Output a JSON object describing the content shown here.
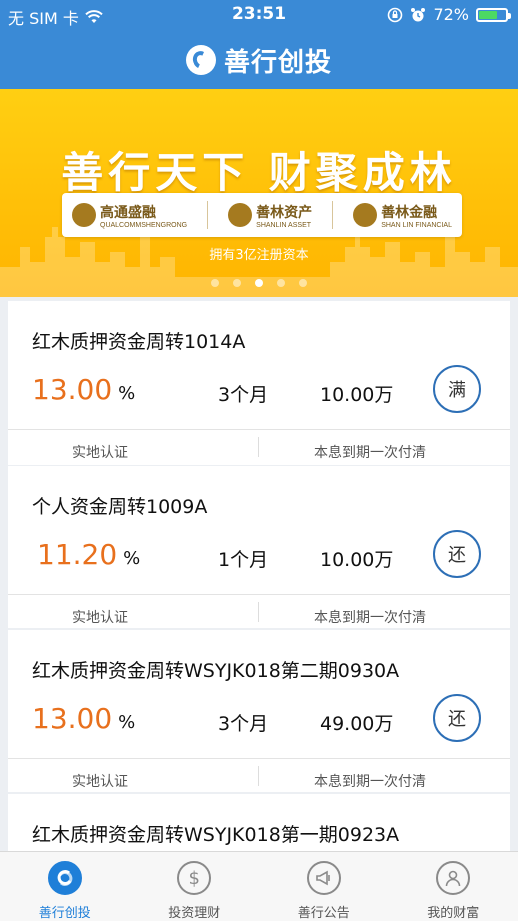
{
  "status_bar": {
    "carrier": "无 SIM 卡",
    "time": "23:51",
    "battery": "72%",
    "battery_level": 0.72
  },
  "header": {
    "title": "善行创投"
  },
  "banner": {
    "headline": "善行天下  财聚成林",
    "brands": [
      {
        "name": "高通盛融",
        "sub": "QUALCOMMSHENGRONG"
      },
      {
        "name": "善林资产",
        "sub": "SHANLIN ASSET"
      },
      {
        "name": "善林金融",
        "sub": "SHAN LIN FINANCIAL"
      }
    ],
    "subtitle": "拥有3亿注册资本",
    "slide_count": 5,
    "active_slide": 3
  },
  "products": [
    {
      "title": "红木质押资金周转1014A",
      "rate": "13.00",
      "unit": "%",
      "term": "3个月",
      "amount": "10.00万",
      "status": "满",
      "tag1": "实地认证",
      "tag2": "本息到期一次付清"
    },
    {
      "title": "个人资金周转1009A",
      "rate": "11.20",
      "unit": "%",
      "term": "1个月",
      "amount": "10.00万",
      "status": "还",
      "tag1": "实地认证",
      "tag2": "本息到期一次付清"
    },
    {
      "title": "红木质押资金周转WSYJK018第二期0930A",
      "rate": "13.00",
      "unit": "%",
      "term": "3个月",
      "amount": "49.00万",
      "status": "还",
      "tag1": "实地认证",
      "tag2": "本息到期一次付清"
    },
    {
      "title": "红木质押资金周转WSYJK018第一期0923A"
    }
  ],
  "tabbar": [
    {
      "label": "善行创投",
      "icon": "shanxing-logo-icon",
      "active": true
    },
    {
      "label": "投资理财",
      "icon": "dollar-coin-icon",
      "active": false
    },
    {
      "label": "善行公告",
      "icon": "megaphone-icon",
      "active": false
    },
    {
      "label": "我的财富",
      "icon": "user-icon",
      "active": false
    }
  ],
  "colors": {
    "header_bg": "#3a8ad6",
    "banner_bg": "#ffc107",
    "rate_text": "#e8701d",
    "status_circle": "#2d6fb6",
    "tab_active": "#1f7fd8"
  }
}
